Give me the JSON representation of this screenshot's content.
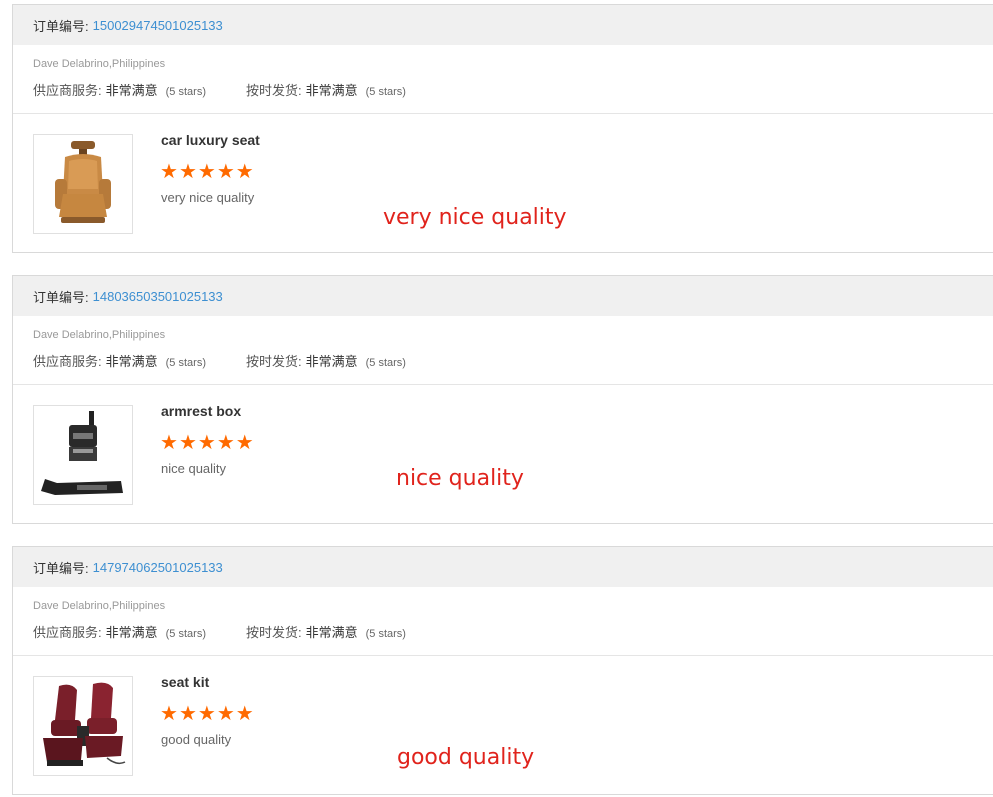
{
  "labels": {
    "order_number": "订单编号:",
    "supplier_service": "供应商服务:",
    "on_time_delivery": "按时发货:",
    "rating_value": "非常满意",
    "rating_stars": "(5 stars)"
  },
  "orders": [
    {
      "order_number": "150029474501025133",
      "buyer": "Dave Delabrino,Philippines",
      "product_name": "car luxury seat",
      "stars": 5,
      "review": "very nice quality",
      "annotation": "very nice quality",
      "image": "car-seat-icon"
    },
    {
      "order_number": "148036503501025133",
      "buyer": "Dave Delabrino,Philippines",
      "product_name": "armrest box",
      "stars": 5,
      "review": "nice quality",
      "annotation": "nice quality",
      "image": "armrest-box-icon"
    },
    {
      "order_number": "147974062501025133",
      "buyer": "Dave Delabrino,Philippines",
      "product_name": "seat kit",
      "stars": 5,
      "review": "good quality",
      "annotation": "good quality",
      "image": "seat-kit-icon"
    }
  ],
  "colors": {
    "link": "#3d8fd1",
    "star": "#ff6a00",
    "annotation": "#e0231c",
    "header_bg": "#f0f0f0"
  }
}
